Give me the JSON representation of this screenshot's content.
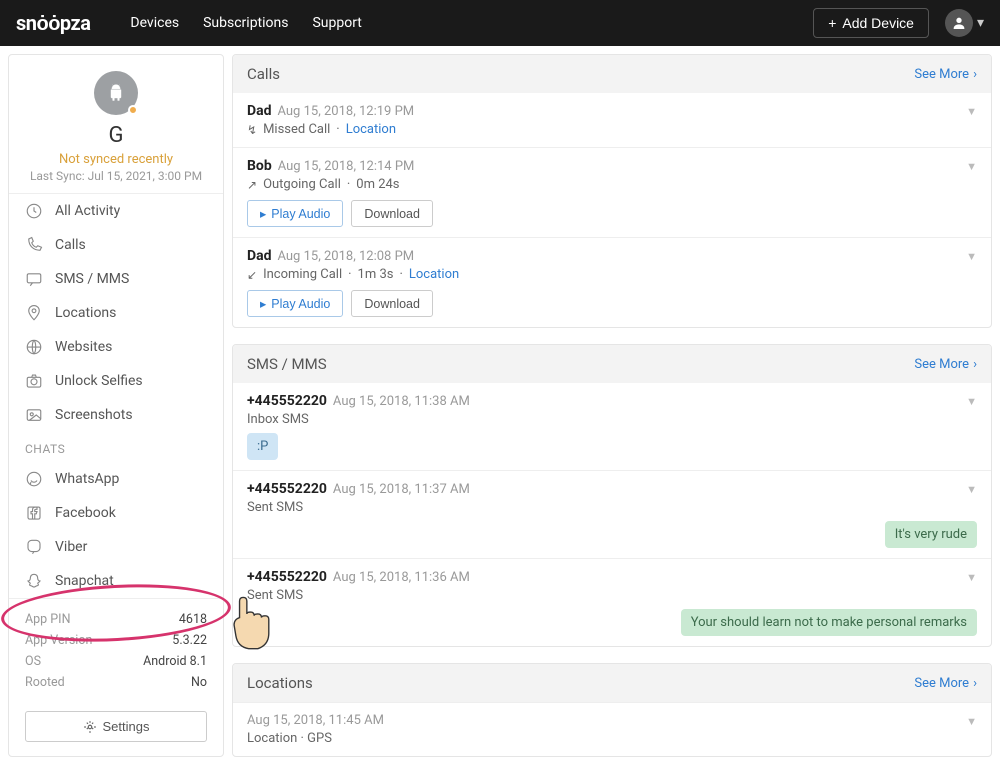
{
  "navbar": {
    "logo": "snoopza",
    "links": [
      "Devices",
      "Subscriptions",
      "Support"
    ],
    "add_device": "Add Device"
  },
  "device": {
    "name": "G",
    "sync_status": "Not synced recently",
    "last_sync": "Last Sync: Jul 15, 2021, 3:00 PM"
  },
  "menu": {
    "items": [
      {
        "label": "All Activity",
        "icon": "clock"
      },
      {
        "label": "Calls",
        "icon": "phone"
      },
      {
        "label": "SMS / MMS",
        "icon": "message"
      },
      {
        "label": "Locations",
        "icon": "pin"
      },
      {
        "label": "Websites",
        "icon": "globe"
      },
      {
        "label": "Unlock Selfies",
        "icon": "camera"
      },
      {
        "label": "Screenshots",
        "icon": "image"
      }
    ],
    "chats_header": "CHATS",
    "chats": [
      {
        "label": "WhatsApp",
        "icon": "whatsapp"
      },
      {
        "label": "Facebook",
        "icon": "facebook"
      },
      {
        "label": "Viber",
        "icon": "viber"
      },
      {
        "label": "Snapchat",
        "icon": "snapchat"
      }
    ]
  },
  "device_info": {
    "rows": [
      {
        "k": "App PIN",
        "v": "4618"
      },
      {
        "k": "App Version",
        "v": "5.3.22"
      },
      {
        "k": "OS",
        "v": "Android 8.1"
      },
      {
        "k": "Rooted",
        "v": "No"
      }
    ],
    "settings": "Settings"
  },
  "calls_panel": {
    "title": "Calls",
    "see_more": "See More",
    "entries": [
      {
        "name": "Dad",
        "time": "Aug 15, 2018, 12:19 PM",
        "dir": "missed",
        "type": "Missed Call",
        "dur": "",
        "loc": true,
        "actions": []
      },
      {
        "name": "Bob",
        "time": "Aug 15, 2018, 12:14 PM",
        "dir": "out",
        "type": "Outgoing Call",
        "dur": "0m 24s",
        "loc": false,
        "actions": [
          "Play Audio",
          "Download"
        ]
      },
      {
        "name": "Dad",
        "time": "Aug 15, 2018, 12:08 PM",
        "dir": "in",
        "type": "Incoming Call",
        "dur": "1m 3s",
        "loc": true,
        "actions": [
          "Play Audio",
          "Download"
        ]
      }
    ],
    "location_label": "Location"
  },
  "sms_panel": {
    "title": "SMS / MMS",
    "see_more": "See More",
    "entries": [
      {
        "name": "+445552220",
        "time": "Aug 15, 2018, 11:38 AM",
        "type": "Inbox SMS",
        "msg": ":P",
        "dir": "in"
      },
      {
        "name": "+445552220",
        "time": "Aug 15, 2018, 11:37 AM",
        "type": "Sent SMS",
        "msg": "It's very rude",
        "dir": "out"
      },
      {
        "name": "+445552220",
        "time": "Aug 15, 2018, 11:36 AM",
        "type": "Sent SMS",
        "msg": "Your should learn not to make personal remarks",
        "dir": "out"
      }
    ]
  },
  "loc_panel": {
    "title": "Locations",
    "see_more": "See More",
    "time": "Aug 15, 2018, 11:45 AM",
    "sub": "Location · GPS"
  }
}
